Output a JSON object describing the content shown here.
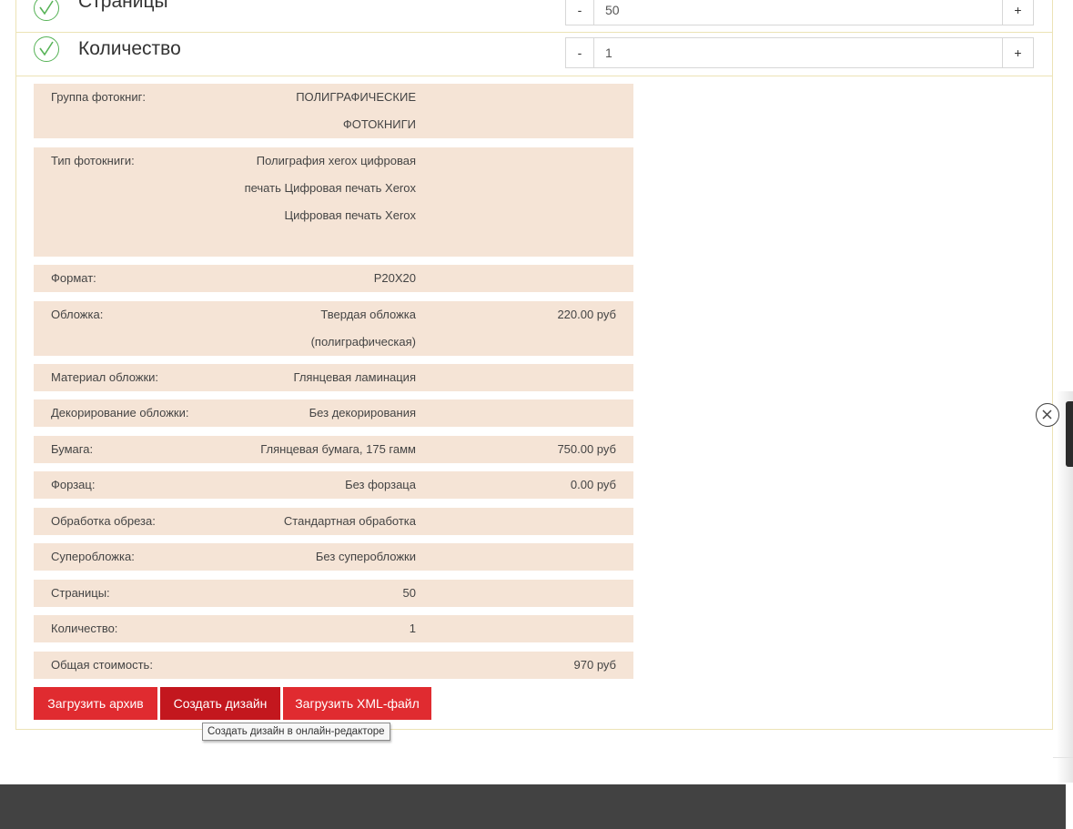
{
  "options": [
    {
      "label": "Страницы",
      "minus": "-",
      "value": "50",
      "plus": "+"
    },
    {
      "label": "Количество",
      "minus": "-",
      "value": "1",
      "plus": "+"
    }
  ],
  "summary": [
    {
      "key": "Группа фотокниг:",
      "value": "ПОЛИГРАФИЧЕСКИЕ ФОТОКНИГИ",
      "price": ""
    },
    {
      "key": "Тип фотокниги:",
      "value": "Полиграфия xerox цифровая печать Цифровая печать Xerox Цифровая печать Xerox",
      "price": ""
    },
    {
      "key": "Формат:",
      "value": "P20X20",
      "price": ""
    },
    {
      "key": "Обложка:",
      "value": "Твердая обложка (полиграфическая)",
      "price": "220.00 руб"
    },
    {
      "key": "Материал обложки:",
      "value": "Глянцевая ламинация",
      "price": ""
    },
    {
      "key": "Декорирование обложки:",
      "value": "Без декорирования",
      "price": ""
    },
    {
      "key": "Бумага:",
      "value": "Глянцевая бумага, 175 гамм",
      "price": "750.00 руб"
    },
    {
      "key": "Форзац:",
      "value": "Без форзаца",
      "price": "0.00 руб"
    },
    {
      "key": "Обработка обреза:",
      "value": "Стандартная обработка",
      "price": ""
    },
    {
      "key": "Суперобложка:",
      "value": "Без суперобложки",
      "price": ""
    },
    {
      "key": "Страницы:",
      "value": "50",
      "price": ""
    },
    {
      "key": "Количество:",
      "value": "1",
      "price": ""
    },
    {
      "key": "Общая стоимость:",
      "value": "",
      "price": "970 руб"
    }
  ],
  "buttons": {
    "upload_archive": "Загрузить архив",
    "create_design": "Создать дизайн",
    "upload_xml": "Загрузить XML-файл"
  },
  "tooltip": "Создать дизайн в онлайн-редакторе",
  "icons": {
    "check": "check-circle-icon",
    "close": "close-circle-icon"
  },
  "colors": {
    "accent": "#e02b30",
    "row_bg": "#f5e4d6",
    "check": "#57b357",
    "footer": "#424242"
  }
}
